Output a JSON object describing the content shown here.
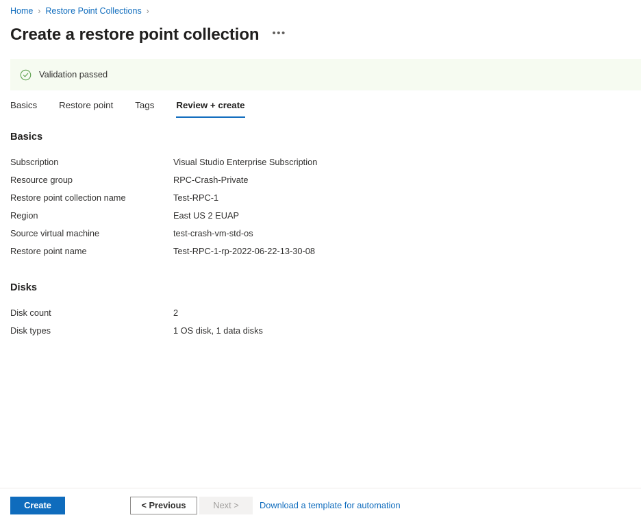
{
  "breadcrumb": {
    "items": [
      {
        "label": "Home"
      },
      {
        "label": "Restore Point Collections"
      }
    ],
    "separator": "›"
  },
  "header": {
    "title": "Create a restore point collection",
    "more_label": "•••"
  },
  "banner": {
    "text": "Validation passed",
    "icon": "check-circle-icon",
    "background_color": "#f6fbf1",
    "icon_color": "#5a9e4b"
  },
  "tabs": [
    {
      "label": "Basics",
      "active": false
    },
    {
      "label": "Restore point",
      "active": false
    },
    {
      "label": "Tags",
      "active": false
    },
    {
      "label": "Review + create",
      "active": true
    }
  ],
  "sections": [
    {
      "title": "Basics",
      "rows": [
        {
          "label": "Subscription",
          "value": "Visual Studio Enterprise Subscription"
        },
        {
          "label": "Resource group",
          "value": "RPC-Crash-Private"
        },
        {
          "label": "Restore point collection name",
          "value": "Test-RPC-1"
        },
        {
          "label": "Region",
          "value": "East US 2 EUAP"
        },
        {
          "label": "Source virtual machine",
          "value": "test-crash-vm-std-os"
        },
        {
          "label": "Restore point name",
          "value": "Test-RPC-1-rp-2022-06-22-13-30-08"
        }
      ]
    },
    {
      "title": "Disks",
      "rows": [
        {
          "label": "Disk count",
          "value": "2"
        },
        {
          "label": "Disk types",
          "value": "1 OS disk, 1 data disks"
        }
      ]
    }
  ],
  "footer": {
    "create_label": "Create",
    "previous_label": "< Previous",
    "next_label": "Next >",
    "template_link_label": "Download a template for automation",
    "accent_color": "#0f6cbd"
  }
}
